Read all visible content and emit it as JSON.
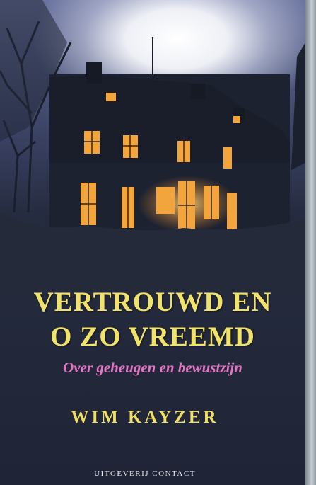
{
  "cover": {
    "title_line_1": "VERTROUWD EN",
    "title_line_2": "O ZO VREEMD",
    "subtitle": "Over geheugen en bewustzijn",
    "author": "WIM KAYZER",
    "publisher": "UITGEVERIJ CONTACT"
  },
  "colors": {
    "title": "#f1e36a",
    "subtitle": "#e274c4",
    "author": "#f0df65",
    "publisher": "#e9ebf2",
    "background": "#262c3f",
    "window_light": "#f6b24a"
  }
}
